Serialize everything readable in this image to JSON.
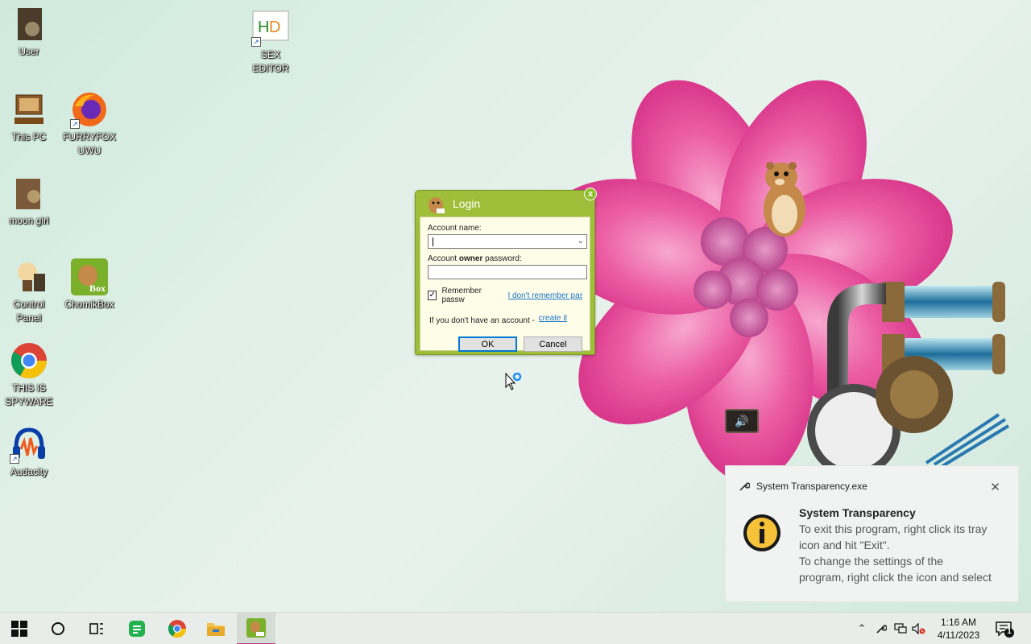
{
  "desktop": {
    "icons": [
      {
        "label": "User"
      },
      {
        "label": "SEX\nEDITOR"
      },
      {
        "label": "This PC"
      },
      {
        "label": "FURRYFOX\nUWU"
      },
      {
        "label": "moon girl"
      },
      {
        "label": "Control\nPanel"
      },
      {
        "label": "ChomikBox"
      },
      {
        "label": "THIS IS\nSPYWARE"
      },
      {
        "label": "Audacity"
      }
    ],
    "chomik_badge": "Box"
  },
  "login": {
    "title": "Login",
    "close_glyph": "x",
    "account_label": "Account name:",
    "account_value": "",
    "password_label_pre": "Account ",
    "password_label_bold": "owner",
    "password_label_post": " password:",
    "remember_label": "Remember passw",
    "remember_checked": true,
    "forgot_link": "I don't remember pas",
    "create_text": "If you don't have an account - ",
    "create_link": "create it",
    "ok_label": "OK",
    "cancel_label": "Cancel"
  },
  "toast": {
    "app_name": "System Transparency.exe",
    "title": "System Transparency",
    "lines": [
      "To exit this program, right click its tray",
      "icon and hit \"Exit\".",
      "To change the settings of the",
      "program, right click the icon and select"
    ],
    "icon": "info-icon"
  },
  "taskbar": {
    "apps": [
      "windows-start-icon",
      "search-circle-icon",
      "task-view-icon",
      "chat-app-icon",
      "chrome-icon",
      "file-explorer-icon",
      "chomikbox-icon"
    ],
    "active_app": "chomikbox-icon",
    "time": "1:16 AM",
    "date": "4/11/2023",
    "notification_count": "1",
    "accent_color": "#c2358a"
  }
}
